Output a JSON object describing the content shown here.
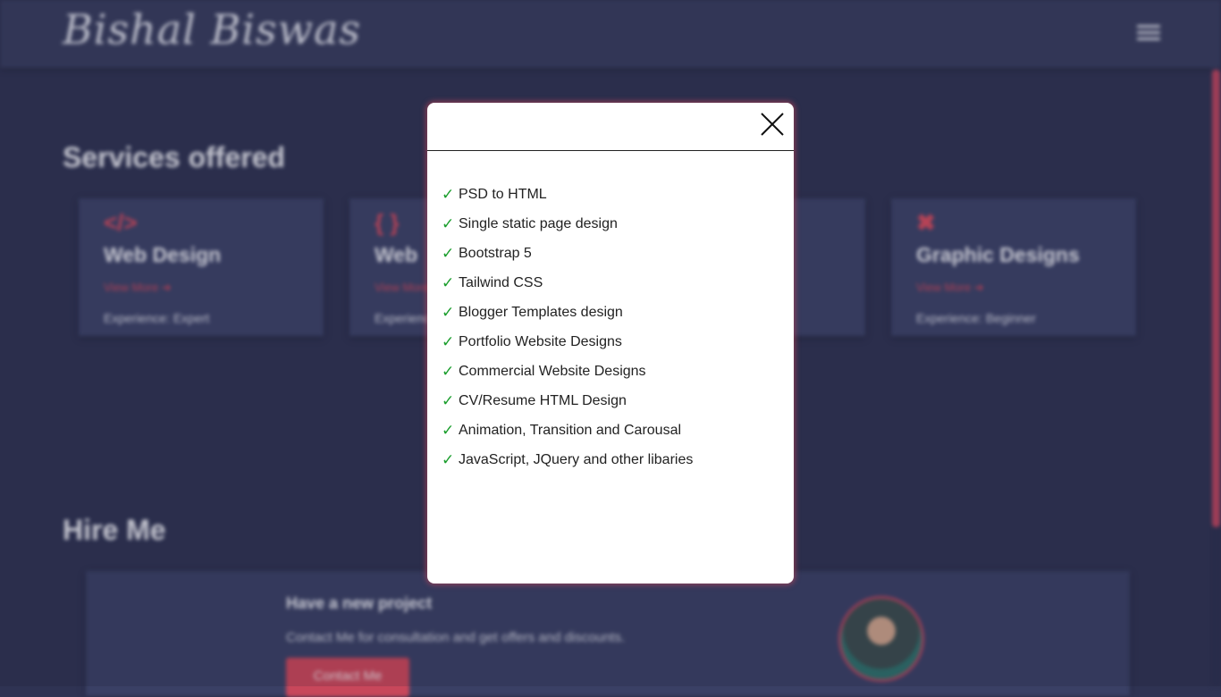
{
  "navbar": {
    "logo": "Bishal Biswas",
    "menu_icon": "hamburger-menu-icon"
  },
  "services": {
    "title": "Services offered",
    "cards": [
      {
        "icon": "code-icon",
        "icon_glyph": "</>",
        "title": "Web Design",
        "link": "View More",
        "experience": "Experience: Expert"
      },
      {
        "icon": "curly-braces-icon",
        "icon_glyph": "{ }",
        "title": "Web",
        "link": "View More",
        "experience": "Experience"
      },
      {
        "icon": "card-icon",
        "icon_glyph": "",
        "title": "",
        "link": "",
        "experience": ""
      },
      {
        "icon": "design-tools-icon",
        "icon_glyph": "✖",
        "title": "Graphic Designs",
        "link": "View More",
        "experience": "Experience: Beginner"
      }
    ]
  },
  "hire": {
    "title": "Hire Me",
    "heading": "Have a new project",
    "text": "Contact Me for consultation and get offers and discounts.",
    "button": "Contact Me"
  },
  "modal": {
    "close_icon": "close-icon",
    "check_glyph": "✓",
    "items": [
      "PSD to HTML",
      "Single static page design",
      "Bootstrap 5",
      "Tailwind CSS",
      "Blogger Templates design",
      "Portfolio Website Designs",
      "Commercial Website Designs",
      "CV/Resume HTML Design",
      "Animation, Transition and Carousal",
      "JavaScript, JQuery and other libaries"
    ]
  },
  "colors": {
    "background": "#2f3353",
    "navbar": "#383d5f",
    "card": "#3c4268",
    "accent": "#c8475b",
    "check": "#1a9e2c"
  }
}
